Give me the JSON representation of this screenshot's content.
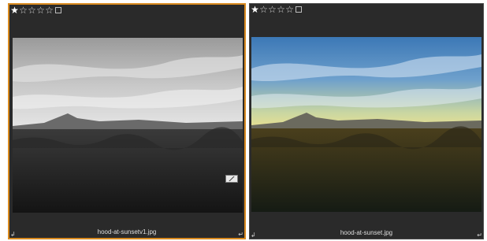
{
  "cells": [
    {
      "filename": "hood-at-sunsetv1.jpg",
      "rating": {
        "filled": 1,
        "total": 5
      },
      "selected": true,
      "has_edit_badge": true,
      "style": "monochrome"
    },
    {
      "filename": "hood-at-sunset.jpg",
      "rating": {
        "filled": 1,
        "total": 5
      },
      "selected": false,
      "has_edit_badge": false,
      "style": "color"
    }
  ],
  "colors": {
    "selection_border": "#d98a1f",
    "cell_background": "#2a2a2a"
  },
  "icons": {
    "star_filled": "★",
    "star_empty": "☆",
    "rotate_left": "↲",
    "rotate_right": "↵"
  }
}
